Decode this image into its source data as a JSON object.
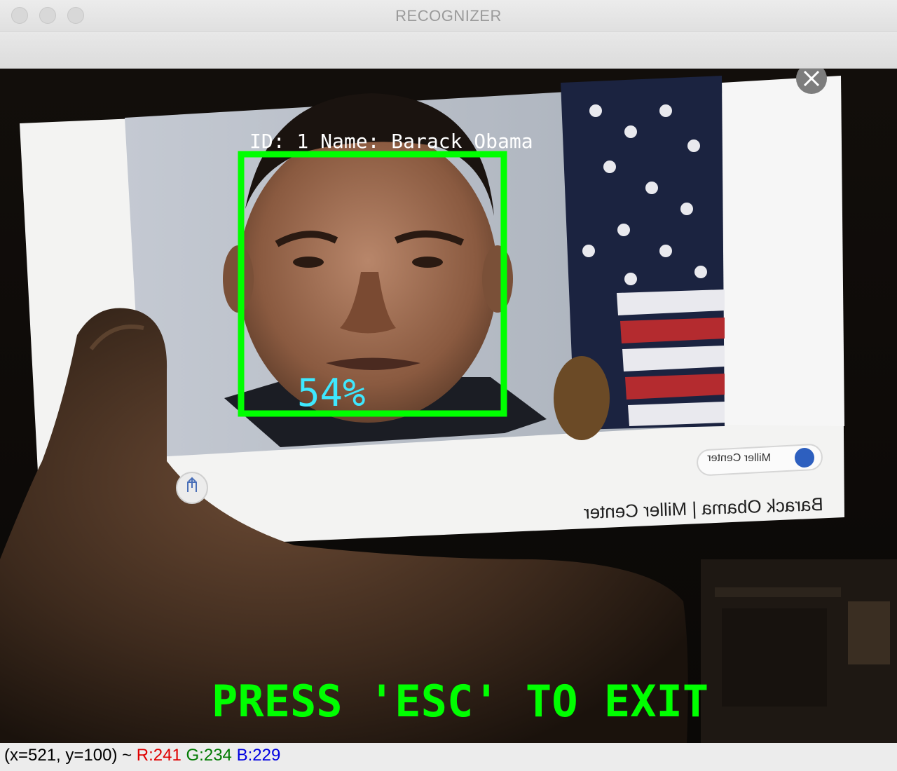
{
  "window": {
    "title": "RECOGNIZER"
  },
  "overlay": {
    "label": "ID: 1 Name: Barack Obama",
    "confidence": "54%",
    "exit_hint": "PRESS 'ESC' TO EXIT",
    "box_color": "#00ff00",
    "label_color": "#ffffff",
    "confidence_color": "#3ee8ff"
  },
  "photo": {
    "caption": "Barack Obama | Miller Center",
    "source_chip": "Miller Center"
  },
  "status": {
    "coords": "(x=521, y=100) ~",
    "r": "R:241",
    "g": "G:234",
    "b": "B:229"
  }
}
